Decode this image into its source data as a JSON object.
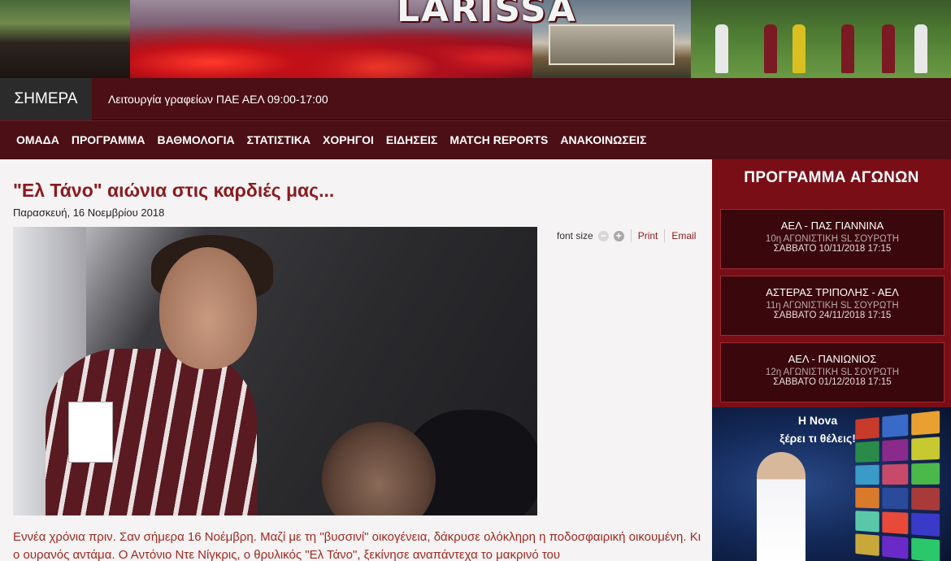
{
  "banner": {
    "logo_text": "LARISSA"
  },
  "ticker": {
    "label": "ΣΗΜΕΡΑ",
    "text": "Λειτουργία γραφείων ΠΑΕ ΑΕΛ 09:00-17:00"
  },
  "nav": {
    "items": [
      "ΟΜΑΔΑ",
      "ΠΡΟΓΡΑΜΜΑ",
      "ΒΑΘΜΟΛΟΓΙΑ",
      "ΣΤΑΤΙΣΤΙΚΑ",
      "ΧΟΡΗΓΟΙ",
      "ΕΙΔΗΣΕΙΣ",
      "MATCH REPORTS",
      "ΑΝΑΚΟΙΝΩΣΕΙΣ"
    ]
  },
  "article": {
    "title": "\"Ελ Τάνο\" αιώνια στις καρδιές μας...",
    "date": "Παρασκευή, 16 Νοεμβρίου 2018",
    "tools": {
      "font_size_label": "font size",
      "print_label": "Print",
      "email_label": "Email"
    },
    "body": "Εννέα χρόνια πριν. Σαν σήμερα 16 Νοέμβρη. Μαζί με τη \"βυσσινί\" οικογένεια, δάκρυσε ολόκληρη η ποδοσφαιρική οικουμένη. Κι ο ουρανός αντάμα. Ο Αντόνιο Ντε Νίγκρις, ο θρυλικός \"Ελ Τάνο\", ξεκίνησε αναπάντεχα το μακρινό του"
  },
  "sidebar": {
    "title": "ΠΡΟΓΡΑΜΜΑ ΑΓΩΝΩΝ",
    "matches": [
      {
        "teams": "ΑΕΛ - ΠΑΣ ΓΙΑΝΝΙΝΑ",
        "round": "10η ΑΓΩΝΙΣΤΙΚΗ SL ΣΟΥΡΩΤΗ",
        "when": "ΣΑΒΒΑΤΟ 10/11/2018 17:15"
      },
      {
        "teams": "ΑΣΤΕΡΑΣ ΤΡΙΠΟΛΗΣ - ΑΕΛ",
        "round": "11η ΑΓΩΝΙΣΤΙΚΗ SL ΣΟΥΡΩΤΗ",
        "when": "ΣΑΒΒΑΤΟ 24/11/2018 17:15"
      },
      {
        "teams": "ΑΕΛ - ΠΑΝΙΩΝΙΟΣ",
        "round": "12η ΑΓΩΝΙΣΤΙΚΗ SL ΣΟΥΡΩΤΗ",
        "when": "ΣΑΒΒΑΤΟ 01/12/2018 17:15"
      }
    ]
  },
  "ad": {
    "line1": "Η Nova",
    "line2": "ξέρει τι θέλεις!"
  },
  "colors": {
    "brand_maroon": "#4b0f15",
    "sidebar_red": "#7a0e17",
    "title_red": "#8a1a1f"
  }
}
